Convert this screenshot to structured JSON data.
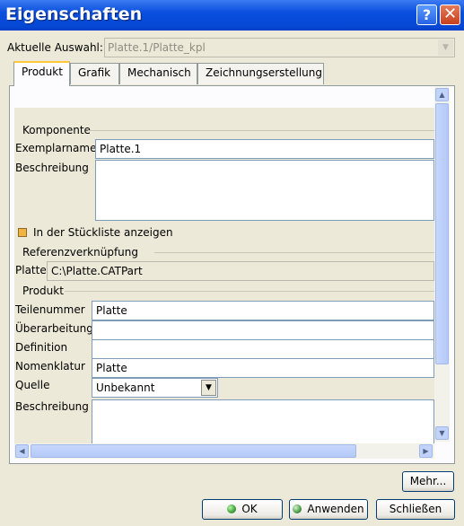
{
  "window": {
    "title": "Eigenschaften",
    "help_glyph": "?",
    "close_glyph": "✕"
  },
  "selection": {
    "label": "Aktuelle Auswahl:",
    "value": "Platte.1/Platte_kpl"
  },
  "tabs": [
    {
      "label": "Produkt",
      "active": true
    },
    {
      "label": "Grafik",
      "active": false
    },
    {
      "label": "Mechanisch",
      "active": false
    },
    {
      "label": "Zeichnungserstellung",
      "active": false
    }
  ],
  "komponente": {
    "title": "Komponente",
    "instance_label": "Exemplarname",
    "instance_value": "Platte.1",
    "description_label": "Beschreibung",
    "description_value": "",
    "bom_label": "In der Stückliste anzeigen",
    "bom_checked": true
  },
  "referenz": {
    "title": "Referenzverknüpfung",
    "label": "Platte",
    "value": "C:\\Platte.CATPart"
  },
  "produkt": {
    "title": "Produkt",
    "part_number_label": "Teilenummer",
    "part_number_value": "Platte",
    "revision_label": "Überarbeitung",
    "revision_value": "",
    "definition_label": "Definition",
    "definition_value": "",
    "nomenclature_label": "Nomenklatur",
    "nomenclature_value": "Platte",
    "source_label": "Quelle",
    "source_value": "Unbekannt",
    "description_label": "Beschreibung",
    "description_value": ""
  },
  "buttons": {
    "more": "Mehr...",
    "ok": "OK",
    "apply": "Anwenden",
    "close": "Schließen"
  },
  "icons": {
    "up": "up-arrow-icon",
    "down": "down-arrow-icon",
    "left": "left-arrow-icon",
    "right": "right-arrow-icon",
    "status": "green-status-icon"
  },
  "colors": {
    "title_bar": "#0a4fde",
    "accent": "#ffc83c",
    "status_green": "#3fa03a"
  }
}
